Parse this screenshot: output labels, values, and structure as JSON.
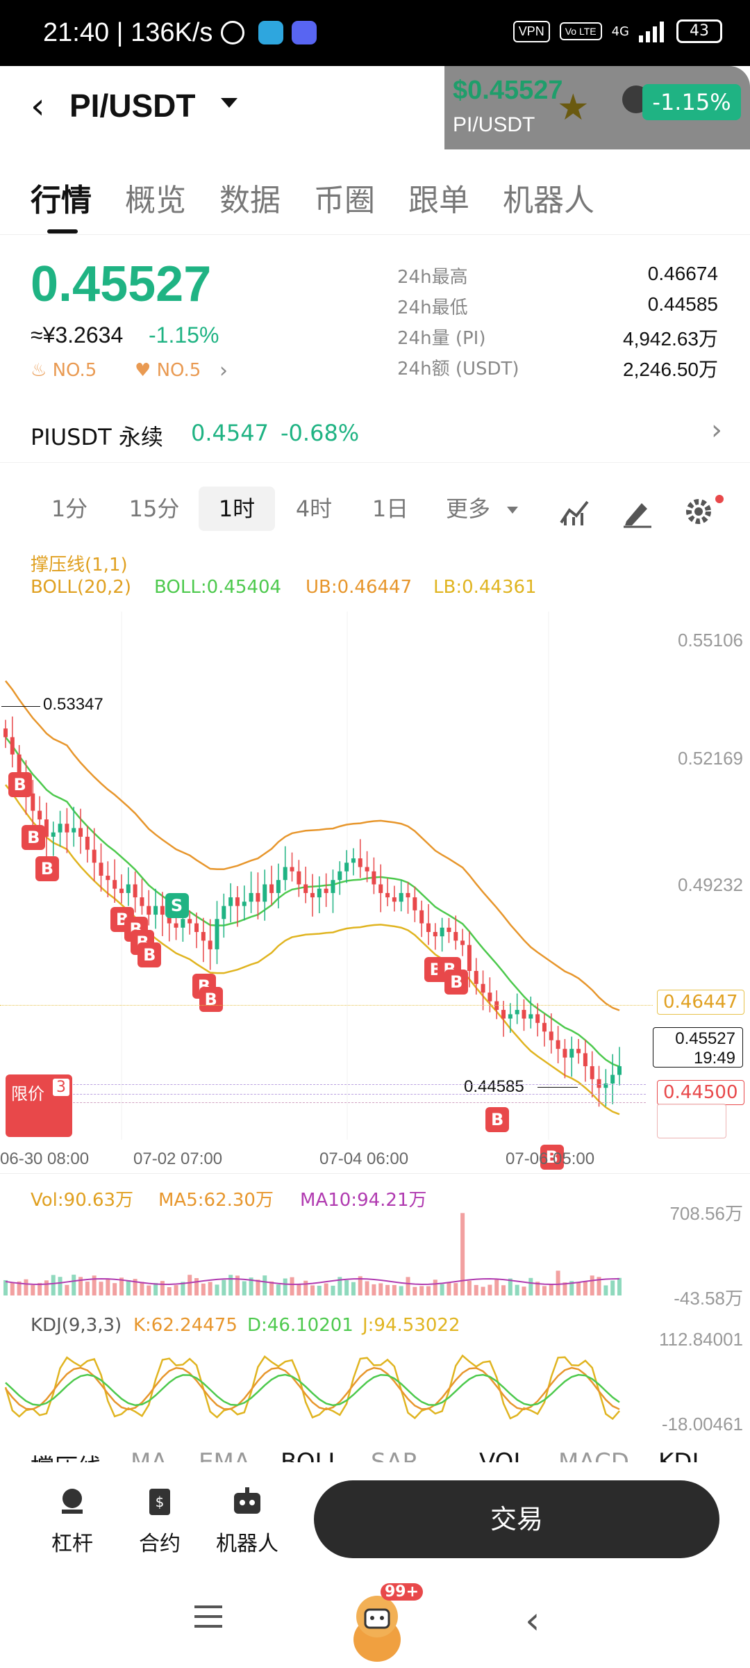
{
  "status_bar": {
    "time": "21:40",
    "speed": "136K/s",
    "vpn": "VPN",
    "volte": "Vo LTE",
    "network": "4G",
    "battery": "43"
  },
  "header": {
    "pair": "PI/USDT",
    "mini_price": "$0.45527",
    "mini_symbol": "PI/USDT",
    "mini_change": "-1.15%"
  },
  "tabs": [
    "行情",
    "概览",
    "数据",
    "币圈",
    "跟单",
    "机器人"
  ],
  "quote": {
    "price": "0.45527",
    "cny": "≈¥3.2634",
    "change": "-1.15%",
    "rank1": "NO.5",
    "rank2": "NO.5",
    "stats": [
      {
        "label": "24h最高",
        "value": "0.46674"
      },
      {
        "label": "24h最低",
        "value": "0.44585"
      },
      {
        "label": "24h量 (PI)",
        "value": "4,942.63万"
      },
      {
        "label": "24h额 (USDT)",
        "value": "2,246.50万"
      }
    ]
  },
  "perp": {
    "name": "PIUSDT 永续",
    "price": "0.4547",
    "change": "-0.68%"
  },
  "intervals": [
    "1分",
    "15分",
    "1时",
    "4时",
    "1日",
    "更多"
  ],
  "colors": {
    "up": "#1fb383",
    "down": "#e8484a",
    "boll_mid": "#4dc94d",
    "boll_upper": "#e7962c",
    "boll_lower": "#e0b420"
  },
  "chart_data": {
    "type": "candlestick",
    "indicator_line1": "撑压线(1,1)",
    "boll": {
      "label": "BOLL(20,2)",
      "mid": "BOLL:0.45404",
      "ub": "UB:0.46447",
      "lb": "LB:0.44361"
    },
    "y_ticks": [
      "0.55106",
      "0.52169",
      "0.49232"
    ],
    "ub_tag": "0.46447",
    "last_price": "0.45527",
    "countdown": "19:49",
    "order_tag": "0.44500",
    "limit_label": "限价",
    "limit_count": "3",
    "high_label": "0.53347",
    "low_label": "0.44585",
    "x_ticks": [
      "06-30 08:00",
      "07-02 07:00",
      "07-04 06:00",
      "07-06 05:00"
    ],
    "close": [
      0.531,
      0.527,
      0.522,
      0.518,
      0.514,
      0.512,
      0.508,
      0.509,
      0.511,
      0.509,
      0.51,
      0.508,
      0.505,
      0.502,
      0.499,
      0.498,
      0.496,
      0.495,
      0.497,
      0.494,
      0.492,
      0.49,
      0.492,
      0.49,
      0.488,
      0.487,
      0.489,
      0.488,
      0.486,
      0.484,
      0.482,
      0.489,
      0.492,
      0.494,
      0.492,
      0.493,
      0.495,
      0.493,
      0.497,
      0.495,
      0.498,
      0.501,
      0.5,
      0.497,
      0.495,
      0.494,
      0.496,
      0.495,
      0.498,
      0.5,
      0.502,
      0.503,
      0.501,
      0.5,
      0.497,
      0.495,
      0.494,
      0.493,
      0.495,
      0.494,
      0.491,
      0.488,
      0.486,
      0.485,
      0.487,
      0.486,
      0.484,
      0.483,
      0.477,
      0.474,
      0.472,
      0.47,
      0.468,
      0.466,
      0.467,
      0.468,
      0.466,
      0.467,
      0.465,
      0.463,
      0.461,
      0.459,
      0.457,
      0.459,
      0.458,
      0.455,
      0.452,
      0.45,
      0.451,
      0.453,
      0.455
    ],
    "volume": {
      "vol": "Vol:90.63万",
      "ma5": "MA5:62.30万",
      "ma10": "MA10:94.21万",
      "y_top": "708.56万",
      "y_bottom": "-43.58万"
    },
    "kdj": {
      "label": "KDJ(9,3,3)",
      "k": "K:62.24475",
      "d": "D:46.10201",
      "j": "J:94.53022",
      "y_top": "112.84001",
      "y_bottom": "-18.00461"
    },
    "indicator_tabs": [
      "撑压线",
      "MA",
      "EMA",
      "BOLL",
      "SAR",
      "VOL",
      "MACD",
      "KDJ"
    ]
  },
  "bottom": {
    "buttons": [
      "杠杆",
      "合约",
      "机器人"
    ],
    "trade": "交易",
    "badge": "99+"
  }
}
